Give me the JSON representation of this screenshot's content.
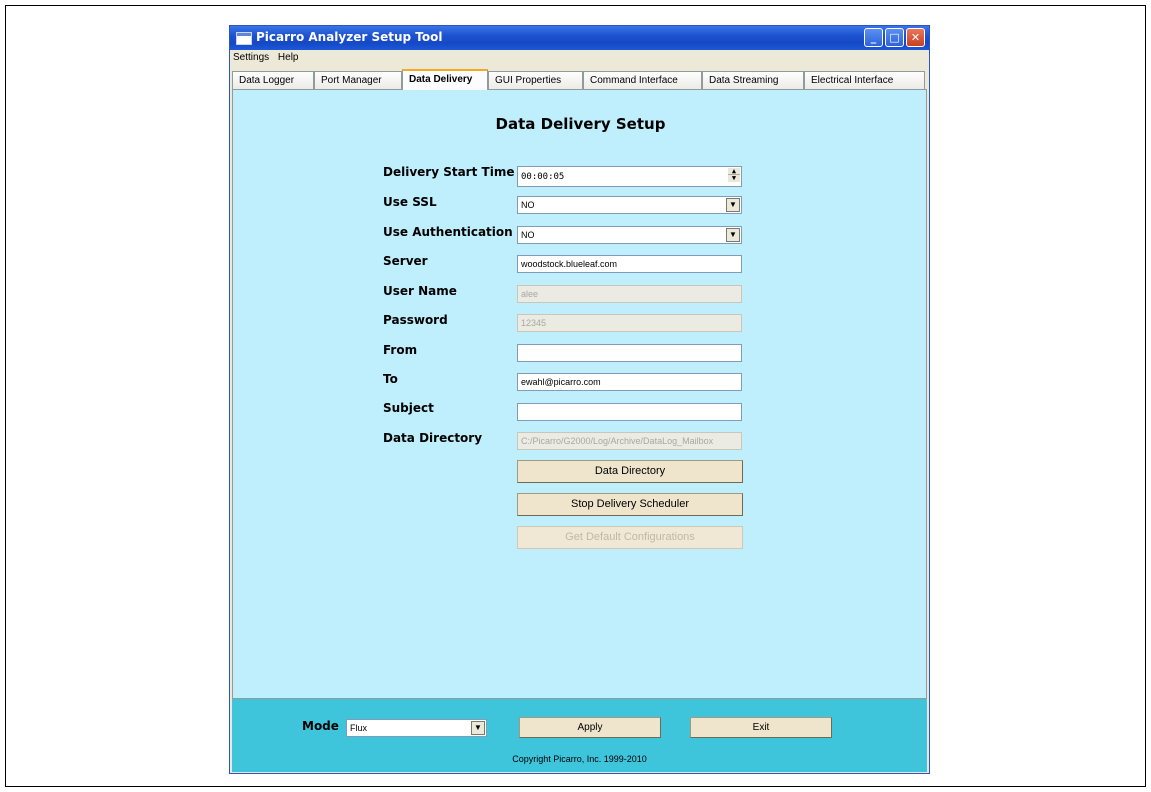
{
  "window": {
    "title": "Picarro Analyzer Setup Tool",
    "minimize": "_",
    "maximize": "□",
    "close": "✕"
  },
  "menu": [
    "Settings",
    "Help"
  ],
  "tabs": [
    {
      "label": "Data Logger",
      "active": false
    },
    {
      "label": "Port Manager",
      "active": false
    },
    {
      "label": "Data Delivery",
      "active": true
    },
    {
      "label": "GUI Properties",
      "active": false
    },
    {
      "label": "Command Interface",
      "active": false
    },
    {
      "label": "Data Streaming",
      "active": false
    },
    {
      "label": "Electrical Interface",
      "active": false
    }
  ],
  "page": {
    "heading": "Data Delivery Setup"
  },
  "form": {
    "delivery_start_time": {
      "label": "Delivery Start Time",
      "value": "00:00:05"
    },
    "use_ssl": {
      "label": "Use SSL",
      "value": "NO"
    },
    "use_authentication": {
      "label": "Use Authentication",
      "value": "NO"
    },
    "server": {
      "label": "Server",
      "value": "woodstock.blueleaf.com"
    },
    "user_name": {
      "label": "User Name",
      "value": "alee"
    },
    "password": {
      "label": "Password",
      "value": "12345"
    },
    "from": {
      "label": "From",
      "value": ""
    },
    "to": {
      "label": "To",
      "value": "ewahl@picarro.com"
    },
    "subject": {
      "label": "Subject",
      "value": ""
    },
    "data_directory": {
      "label": "Data Directory",
      "value": "C:/Picarro/G2000/Log/Archive/DataLog_Mailbox"
    }
  },
  "buttons": {
    "data_directory": "Data Directory",
    "stop_scheduler": "Stop Delivery Scheduler",
    "default_config": "Get Default Configurations"
  },
  "bottom": {
    "mode_label": "Mode",
    "mode_value": "Flux",
    "apply": "Apply",
    "exit": "Exit",
    "copyright": "Copyright Picarro, Inc. 1999-2010"
  },
  "icons": {
    "dropdown": "▼",
    "spin_up": "▲",
    "spin_down": "▼"
  }
}
